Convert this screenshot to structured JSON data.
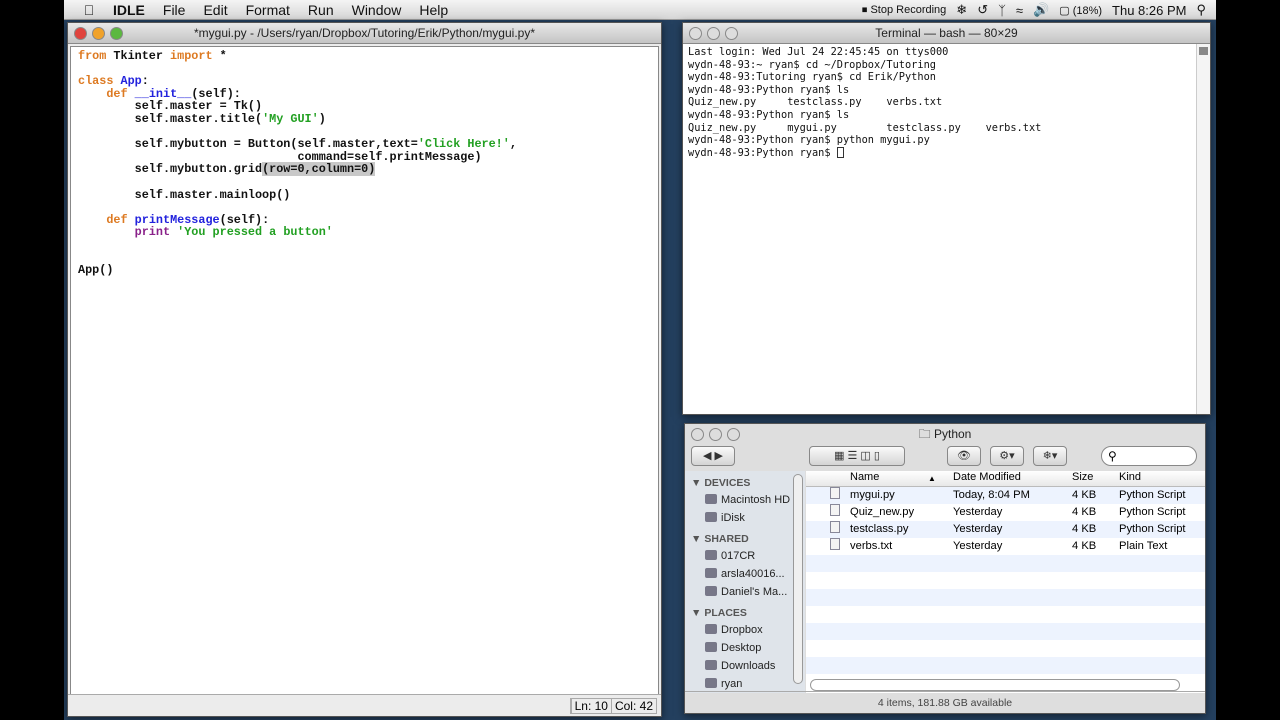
{
  "menubar": {
    "app": "IDLE",
    "items": [
      "File",
      "Edit",
      "Format",
      "Run",
      "Window",
      "Help"
    ],
    "recording": "Stop Recording",
    "battery": "(18%)",
    "clock": "Thu 8:26 PM"
  },
  "idle": {
    "title": "*mygui.py - /Users/ryan/Dropbox/Tutoring/Erik/Python/mygui.py*",
    "ln": "Ln: 10",
    "col": "Col: 42",
    "lines": [
      [
        [
          "from",
          "kw"
        ],
        [
          " Tkinter ",
          ""
        ],
        [
          "import",
          "kw"
        ],
        [
          " *",
          ""
        ]
      ],
      [],
      [
        [
          "class",
          "kw"
        ],
        [
          " ",
          ""
        ],
        [
          "App",
          "def"
        ],
        [
          ":",
          ""
        ]
      ],
      [
        [
          "    ",
          ""
        ],
        [
          "def",
          "kw"
        ],
        [
          " ",
          ""
        ],
        [
          "__init__",
          "def"
        ],
        [
          "(self):",
          ""
        ]
      ],
      [
        [
          "        self.master = Tk()",
          ""
        ]
      ],
      [
        [
          "        self.master.title(",
          ""
        ],
        [
          "'My GUI'",
          "str"
        ],
        [
          ")",
          ""
        ]
      ],
      [],
      [
        [
          "        self.mybutton = Button(self.master,text=",
          ""
        ],
        [
          "'Click Here!'",
          "str"
        ],
        [
          ",",
          ""
        ]
      ],
      [
        [
          "                               command=self.printMessage)",
          ""
        ]
      ],
      [
        [
          "        self.mybutton.grid",
          ""
        ],
        [
          "(row=0,column=0)",
          "sel"
        ]
      ],
      [],
      [
        [
          "        self.master.mainloop()",
          ""
        ]
      ],
      [],
      [
        [
          "    ",
          ""
        ],
        [
          "def",
          "kw"
        ],
        [
          " ",
          ""
        ],
        [
          "printMessage",
          "def"
        ],
        [
          "(self):",
          ""
        ]
      ],
      [
        [
          "        ",
          ""
        ],
        [
          "print",
          "bi"
        ],
        [
          " ",
          ""
        ],
        [
          "'You pressed a button'",
          "str"
        ]
      ],
      [],
      [],
      [
        [
          "App()",
          ""
        ]
      ]
    ]
  },
  "terminal": {
    "title": "Terminal — bash — 80×29",
    "lines": [
      "Last login: Wed Jul 24 22:45:45 on ttys000",
      "wydn-48-93:~ ryan$ cd ~/Dropbox/Tutoring",
      "wydn-48-93:Tutoring ryan$ cd Erik/Python",
      "wydn-48-93:Python ryan$ ls",
      "Quiz_new.py     testclass.py    verbs.txt",
      "wydn-48-93:Python ryan$ ls",
      "Quiz_new.py     mygui.py        testclass.py    verbs.txt",
      "wydn-48-93:Python ryan$ python mygui.py",
      "wydn-48-93:Python ryan$ "
    ]
  },
  "finder": {
    "title": "Python",
    "status": "4 items, 181.88 GB available",
    "sidebar": [
      {
        "head": "DEVICES",
        "items": [
          "Macintosh HD",
          "iDisk"
        ]
      },
      {
        "head": "SHARED",
        "items": [
          "017CR",
          "arsla40016...",
          "Daniel's Ma..."
        ]
      },
      {
        "head": "PLACES",
        "items": [
          "Dropbox",
          "Desktop",
          "Downloads",
          "ryan"
        ]
      }
    ],
    "columns": [
      "Name",
      "Date Modified",
      "Size",
      "Kind"
    ],
    "files": [
      [
        "mygui.py",
        "Today, 8:04 PM",
        "4 KB",
        "Python Script"
      ],
      [
        "Quiz_new.py",
        "Yesterday",
        "4 KB",
        "Python Script"
      ],
      [
        "testclass.py",
        "Yesterday",
        "4 KB",
        "Python Script"
      ],
      [
        "verbs.txt",
        "Yesterday",
        "4 KB",
        "Plain Text"
      ]
    ]
  }
}
